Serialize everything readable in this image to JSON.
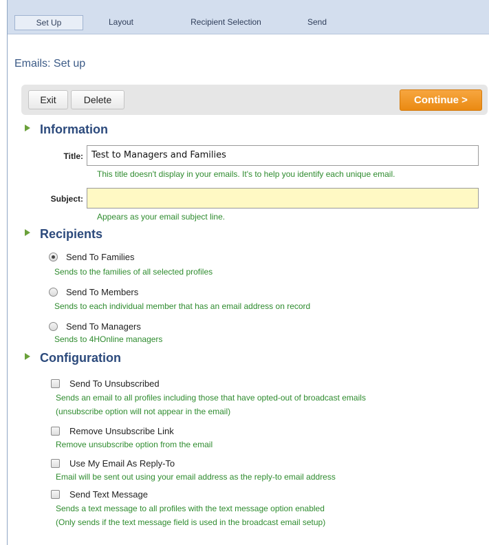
{
  "tabs": [
    {
      "label": "Set Up",
      "active": true
    },
    {
      "label": "Layout",
      "active": false
    },
    {
      "label": "Recipient Selection",
      "active": false
    },
    {
      "label": "Send",
      "active": false
    }
  ],
  "page_title": "Emails: Set up",
  "toolbar": {
    "exit_label": "Exit",
    "delete_label": "Delete",
    "continue_label": "Continue >"
  },
  "information": {
    "heading": "Information",
    "title_label": "Title:",
    "title_value": "Test to Managers and Families",
    "title_help": "This title doesn't display in your emails. It's to help you identify each unique email.",
    "subject_label": "Subject:",
    "subject_value": "",
    "subject_help": "Appears as your email subject line."
  },
  "recipients": {
    "heading": "Recipients",
    "options": [
      {
        "label": "Send To Families",
        "help": "Sends to the families of all selected profiles",
        "selected": true
      },
      {
        "label": "Send To Members",
        "help": "Sends to each individual member that has an email address on record",
        "selected": false
      },
      {
        "label": "Send To Managers",
        "help": "Sends to 4HOnline managers",
        "selected": false
      }
    ]
  },
  "configuration": {
    "heading": "Configuration",
    "options": [
      {
        "label": "Send To Unsubscribed",
        "help1": "Sends an email to all profiles including those that have opted-out of broadcast emails",
        "help2": "(unsubscribe option will not appear in the email)",
        "checked": false
      },
      {
        "label": "Remove Unsubscribe Link",
        "help1": "Remove unsubscribe option from the email",
        "checked": false
      },
      {
        "label": "Use My Email As Reply-To",
        "help1": "Email will be sent out using your email address as the reply-to email address",
        "checked": false
      },
      {
        "label": "Send Text Message",
        "help1": "Sends a text message to all profiles with the text message option enabled",
        "help2": "(Only sends if the text message field is used in the broadcast email setup)",
        "checked": false
      }
    ]
  },
  "colors": {
    "tabbar_bg": "#d3deee",
    "heading": "#2c4a7c",
    "help_text": "#2e8b2e",
    "continue_button": "#ea8a12",
    "subject_field_bg": "#fff9c4"
  }
}
